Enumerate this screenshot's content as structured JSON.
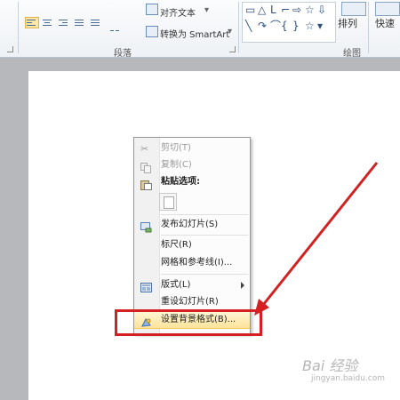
{
  "ribbon": {
    "paragraph_group_label": "段落",
    "drawing_group_label": "绘图",
    "align_text_label": "对齐文本",
    "convert_smartart_label": "转换为 SmartArt",
    "arrange_label": "排列",
    "quick_styles_label": "快速"
  },
  "context_menu": {
    "items": [
      {
        "label": "剪切(T)",
        "icon": "scissors-icon",
        "enabled": false
      },
      {
        "label": "复制(C)",
        "icon": "copy-icon",
        "enabled": false
      },
      {
        "label": "粘贴选项:",
        "icon": "paste-icon",
        "enabled": true
      },
      {
        "label": "发布幻灯片(S)",
        "icon": "publish-slides-icon",
        "enabled": true
      },
      {
        "label": "标尺(R)",
        "enabled": true
      },
      {
        "label": "网格和参考线(I)...",
        "enabled": true
      },
      {
        "label": "版式(L)",
        "icon": "layout-icon",
        "enabled": true,
        "has_submenu": true
      },
      {
        "label": "重设幻灯片(R)",
        "enabled": true
      },
      {
        "label": "设置背景格式(B)...",
        "icon": "format-background-icon",
        "enabled": true,
        "highlighted": true
      }
    ]
  },
  "watermark": {
    "text": "Bai 经验",
    "sub": "jingyan.baidu.com"
  },
  "colors": {
    "annotation_red": "#d42020",
    "highlight": "#fde39a"
  }
}
